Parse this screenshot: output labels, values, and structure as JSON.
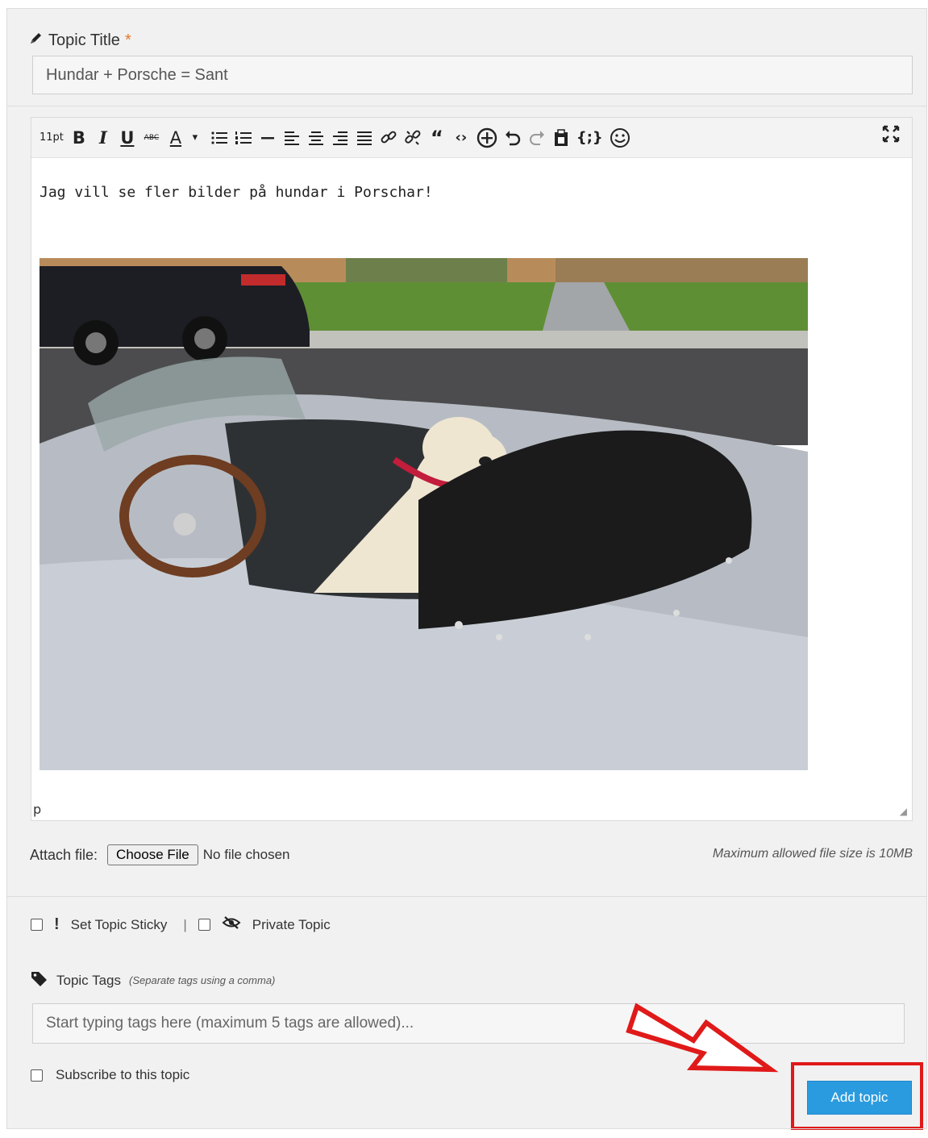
{
  "form": {
    "title_label": "Topic Title",
    "required_mark": "*",
    "title_value": "Hundar + Porsche = Sant"
  },
  "toolbar": {
    "font_size": "11pt",
    "bold": "B",
    "italic": "I",
    "underline": "U",
    "strikethrough": "ABC",
    "text_color": "A",
    "icons": [
      "bulleted-list-icon",
      "numbered-list-icon",
      "horizontal-line-icon",
      "align-left-icon",
      "align-center-icon",
      "align-right-icon",
      "align-justify-icon",
      "link-icon",
      "unlink-icon",
      "blockquote-icon",
      "code-icon",
      "insert-icon",
      "undo-icon",
      "redo-icon",
      "paste-icon",
      "source-code-icon",
      "emoticon-icon",
      "fullscreen-icon"
    ]
  },
  "editor": {
    "body_text": "Jag vill se fler bilder på hundar i Porschar!",
    "path": "p",
    "image_alt": "White puppy sitting in a silver convertible Porsche"
  },
  "attach": {
    "label": "Attach file:",
    "button": "Choose File",
    "status": "No file chosen",
    "max_size": "Maximum allowed file size is 10MB"
  },
  "options": {
    "sticky": "Set Topic Sticky",
    "separator": "|",
    "private": "Private Topic"
  },
  "tags": {
    "label": "Topic Tags",
    "hint": "(Separate tags using a comma)",
    "placeholder": "Start typing tags here (maximum 5 tags are allowed)..."
  },
  "subscribe": {
    "label": "Subscribe to this topic"
  },
  "submit": {
    "label": "Add topic"
  },
  "colors": {
    "accent": "#2b9be0",
    "required": "#e8772a",
    "annotation": "#e01919"
  }
}
